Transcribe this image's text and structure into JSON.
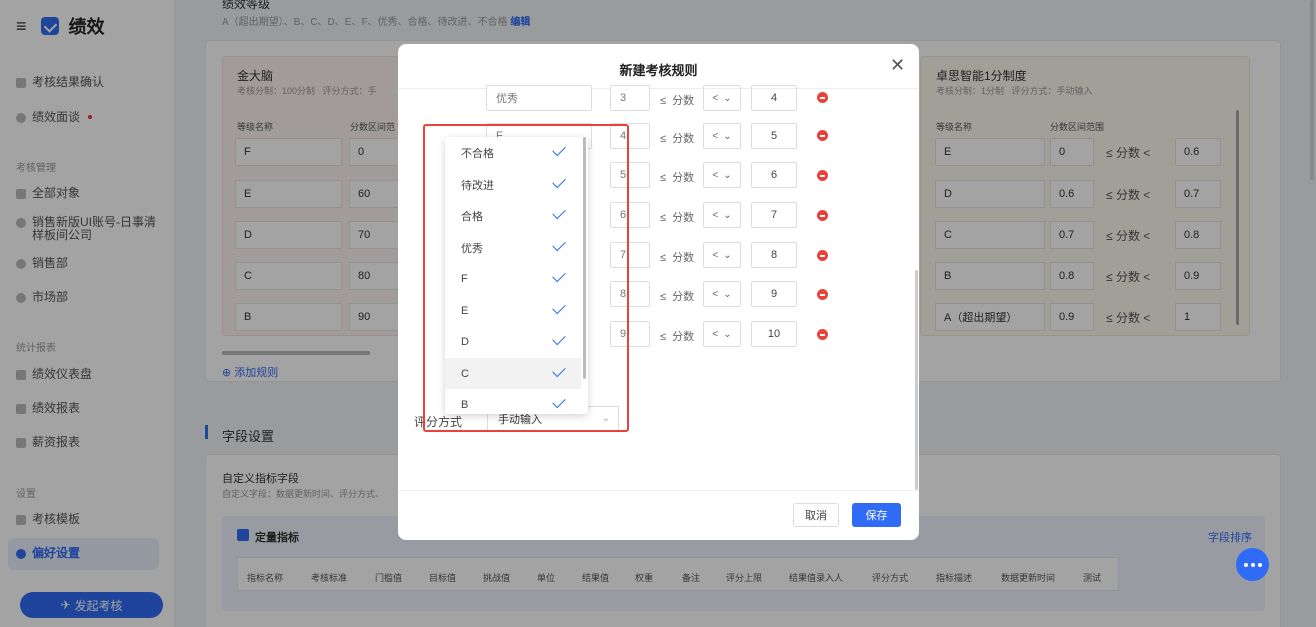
{
  "app": {
    "title": "绩效"
  },
  "sidebar": {
    "items": [
      {
        "label": "考核结果确认"
      },
      {
        "label": "绩效面谈"
      },
      {
        "label": "全部对象"
      },
      {
        "label": "销售新版UI账号-日事清样板间公司"
      },
      {
        "label": "销售部"
      },
      {
        "label": "市场部"
      },
      {
        "label": "绩效仪表盘"
      },
      {
        "label": "绩效报表"
      },
      {
        "label": "薪资报表"
      },
      {
        "label": "考核模板"
      },
      {
        "label": "偏好设置"
      }
    ],
    "sections": [
      "考核管理",
      "统计报表",
      "设置"
    ],
    "launch_button": "发起考核"
  },
  "background": {
    "grade_title": "绩效等级",
    "grade_desc": "A（超出期望）、B、C、D、E、F、优秀、合格、待改进、不合格",
    "edit_link": "编辑",
    "left_rule": {
      "name": "金大脑",
      "meta1": "考核分制：100分制",
      "meta2": "评分方式：手",
      "col_name": "等级名称",
      "col_range": "分数区间范",
      "rows": [
        {
          "name": "F",
          "min": "0"
        },
        {
          "name": "E",
          "min": "60"
        },
        {
          "name": "D",
          "min": "70"
        },
        {
          "name": "C",
          "min": "80"
        },
        {
          "name": "B",
          "min": "90"
        }
      ]
    },
    "right_rule": {
      "name": "卓思智能1分制度",
      "meta1": "考核分制：1分制",
      "meta2": "评分方式：手动输入",
      "col_name": "等级名称",
      "col_range": "分数区间范围",
      "rows": [
        {
          "name": "E",
          "min": "0",
          "max": "0.6"
        },
        {
          "name": "D",
          "min": "0.6",
          "max": "0.7"
        },
        {
          "name": "C",
          "min": "0.7",
          "max": "0.8"
        },
        {
          "name": "B",
          "min": "0.8",
          "max": "0.9"
        },
        {
          "name": "A（超出期望）",
          "min": "0.9",
          "max": "1"
        }
      ],
      "le": "≤",
      "score": "分数",
      "lt": "<"
    },
    "add_rule": "添加规则",
    "field_settings": "字段设置",
    "custom_fields_title": "自定义指标字段",
    "custom_fields_desc": "自定义字段：数据更新时间、评分方式、",
    "quant_title": "定量指标",
    "field_sort": "字段排序",
    "field_headers": [
      "指标名称",
      "考核标准",
      "门槛值",
      "目标值",
      "挑战值",
      "单位",
      "结果值",
      "权重",
      "备注",
      "评分上限",
      "结果值录入人",
      "评分方式",
      "指标描述",
      "数据更新时间",
      "测试"
    ]
  },
  "modal": {
    "title": "新建考核规则",
    "rows": [
      {
        "name": "优秀",
        "min": "3",
        "max": "4"
      },
      {
        "name": "F",
        "min": "4",
        "max": "5"
      },
      {
        "name": "",
        "min": "5",
        "max": "6"
      },
      {
        "name": "",
        "min": "6",
        "max": "7"
      },
      {
        "name": "",
        "min": "7",
        "max": "8"
      },
      {
        "name": "",
        "min": "8",
        "max": "9"
      },
      {
        "name": "",
        "min": "9",
        "max": "10"
      }
    ],
    "le": "≤",
    "score": "分数",
    "lt": "<",
    "score_method_label": "评分方式",
    "score_method_value": "手动输入",
    "cancel": "取消",
    "save": "保存"
  },
  "dropdown": {
    "options": [
      "不合格",
      "待改进",
      "合格",
      "优秀",
      "F",
      "E",
      "D",
      "C",
      "B"
    ],
    "highlighted": "C"
  },
  "colors": {
    "accent": "#2f6bf5",
    "danger": "#e8433a"
  }
}
